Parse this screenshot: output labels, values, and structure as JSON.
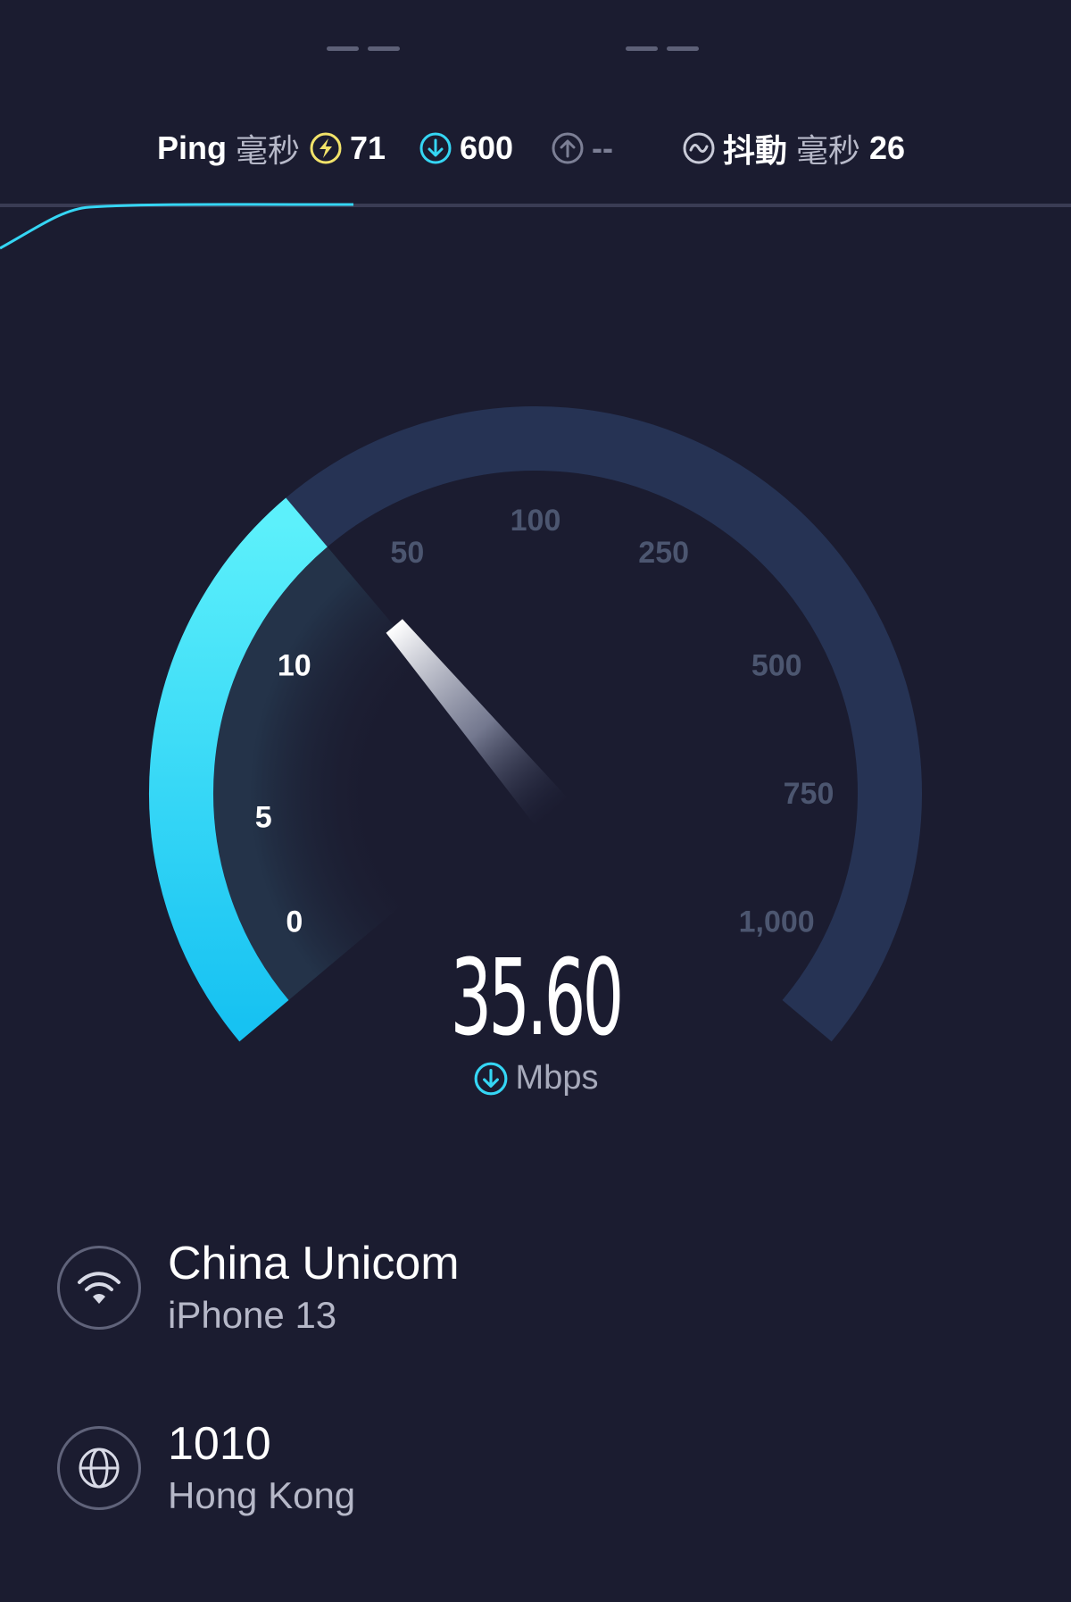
{
  "header": {
    "placeholder_left": "— —",
    "placeholder_right": "— —"
  },
  "metrics": {
    "ping": {
      "label": "Ping",
      "unit": "毫秒",
      "value": "71",
      "icon": "lightning-circle-icon"
    },
    "download": {
      "value": "600",
      "icon": "download-arrow-icon"
    },
    "upload": {
      "value": "--",
      "icon": "upload-arrow-icon"
    },
    "jitter": {
      "label": "抖動",
      "unit": "毫秒",
      "value": "26",
      "icon": "wave-circle-icon"
    }
  },
  "test_progress": 0.33,
  "gauge": {
    "ticks": [
      "0",
      "5",
      "10",
      "50",
      "100",
      "250",
      "500",
      "750",
      "1,000"
    ],
    "reading": 35.6,
    "reading_text": "35.60",
    "unit": "Mbps",
    "unit_icon": "download-arrow-icon",
    "colors": {
      "active": "#35d6f4",
      "track": "#263354",
      "tick_active": "#ffffff",
      "tick_inactive": "#4c5670"
    }
  },
  "connection": {
    "provider": "China Unicom",
    "device": "iPhone 13",
    "icon": "wifi-icon"
  },
  "server": {
    "name": "1010",
    "location": "Hong Kong",
    "icon": "globe-icon"
  }
}
